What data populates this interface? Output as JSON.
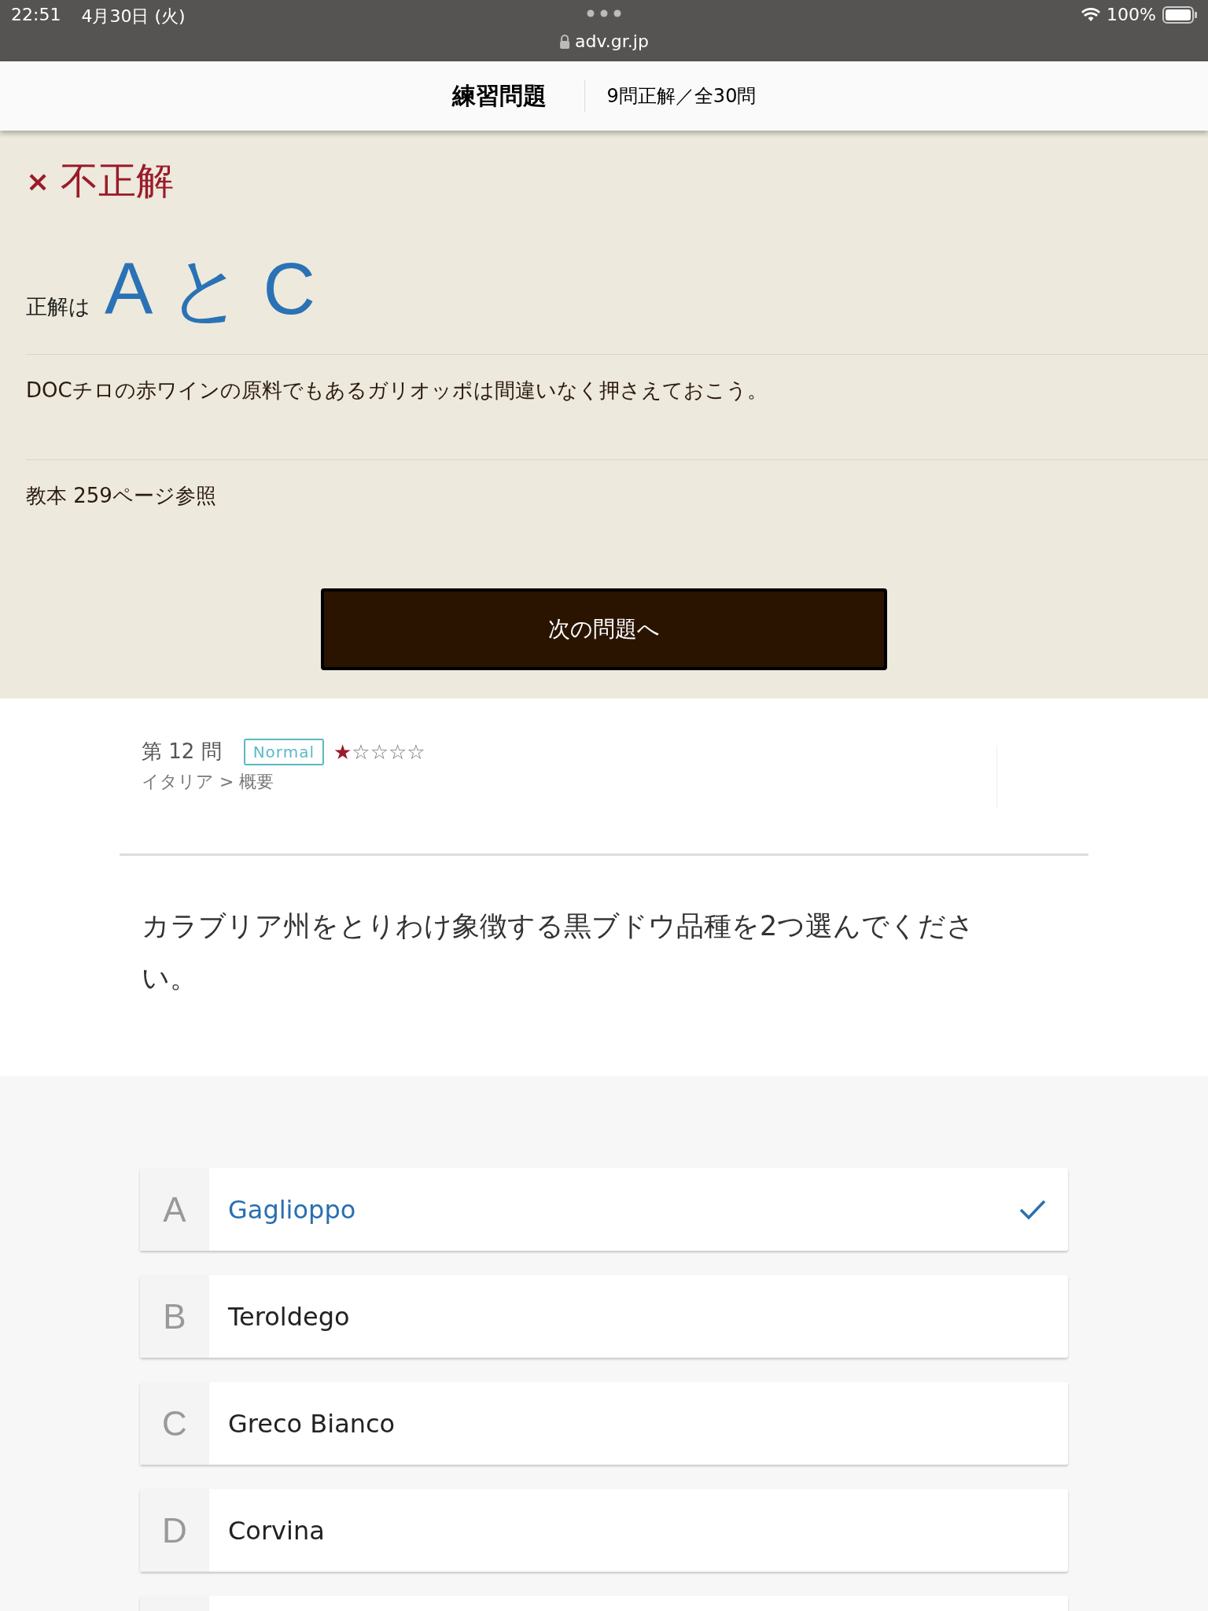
{
  "status_bar": {
    "time": "22:51",
    "date": "4月30日 (火)",
    "url": "adv.gr.jp",
    "battery": "100%"
  },
  "header": {
    "title": "練習問題",
    "score": "9問正解／全30問"
  },
  "result": {
    "verdict_mark": "×",
    "verdict": "不正解",
    "answer_label": "正解は",
    "answer": "A と C",
    "explanation": "DOCチロの赤ワインの原料でもあるガリオッポは間違いなく押さえておこう。",
    "reference": "教本 259ページ参照",
    "next_button": "次の問題へ"
  },
  "question": {
    "number": "第 12 問",
    "level": "Normal",
    "stars": 1,
    "breadcrumb": "イタリア > 概要",
    "text": "カラブリア州をとりわけ象徴する黒ブドウ品種を2つ選んでください。"
  },
  "options": [
    {
      "letter": "A",
      "label": "Gaglioppo",
      "selected": true
    },
    {
      "letter": "B",
      "label": "Teroldego",
      "selected": false
    },
    {
      "letter": "C",
      "label": "Greco Bianco",
      "selected": false
    },
    {
      "letter": "D",
      "label": "Corvina",
      "selected": false
    }
  ]
}
